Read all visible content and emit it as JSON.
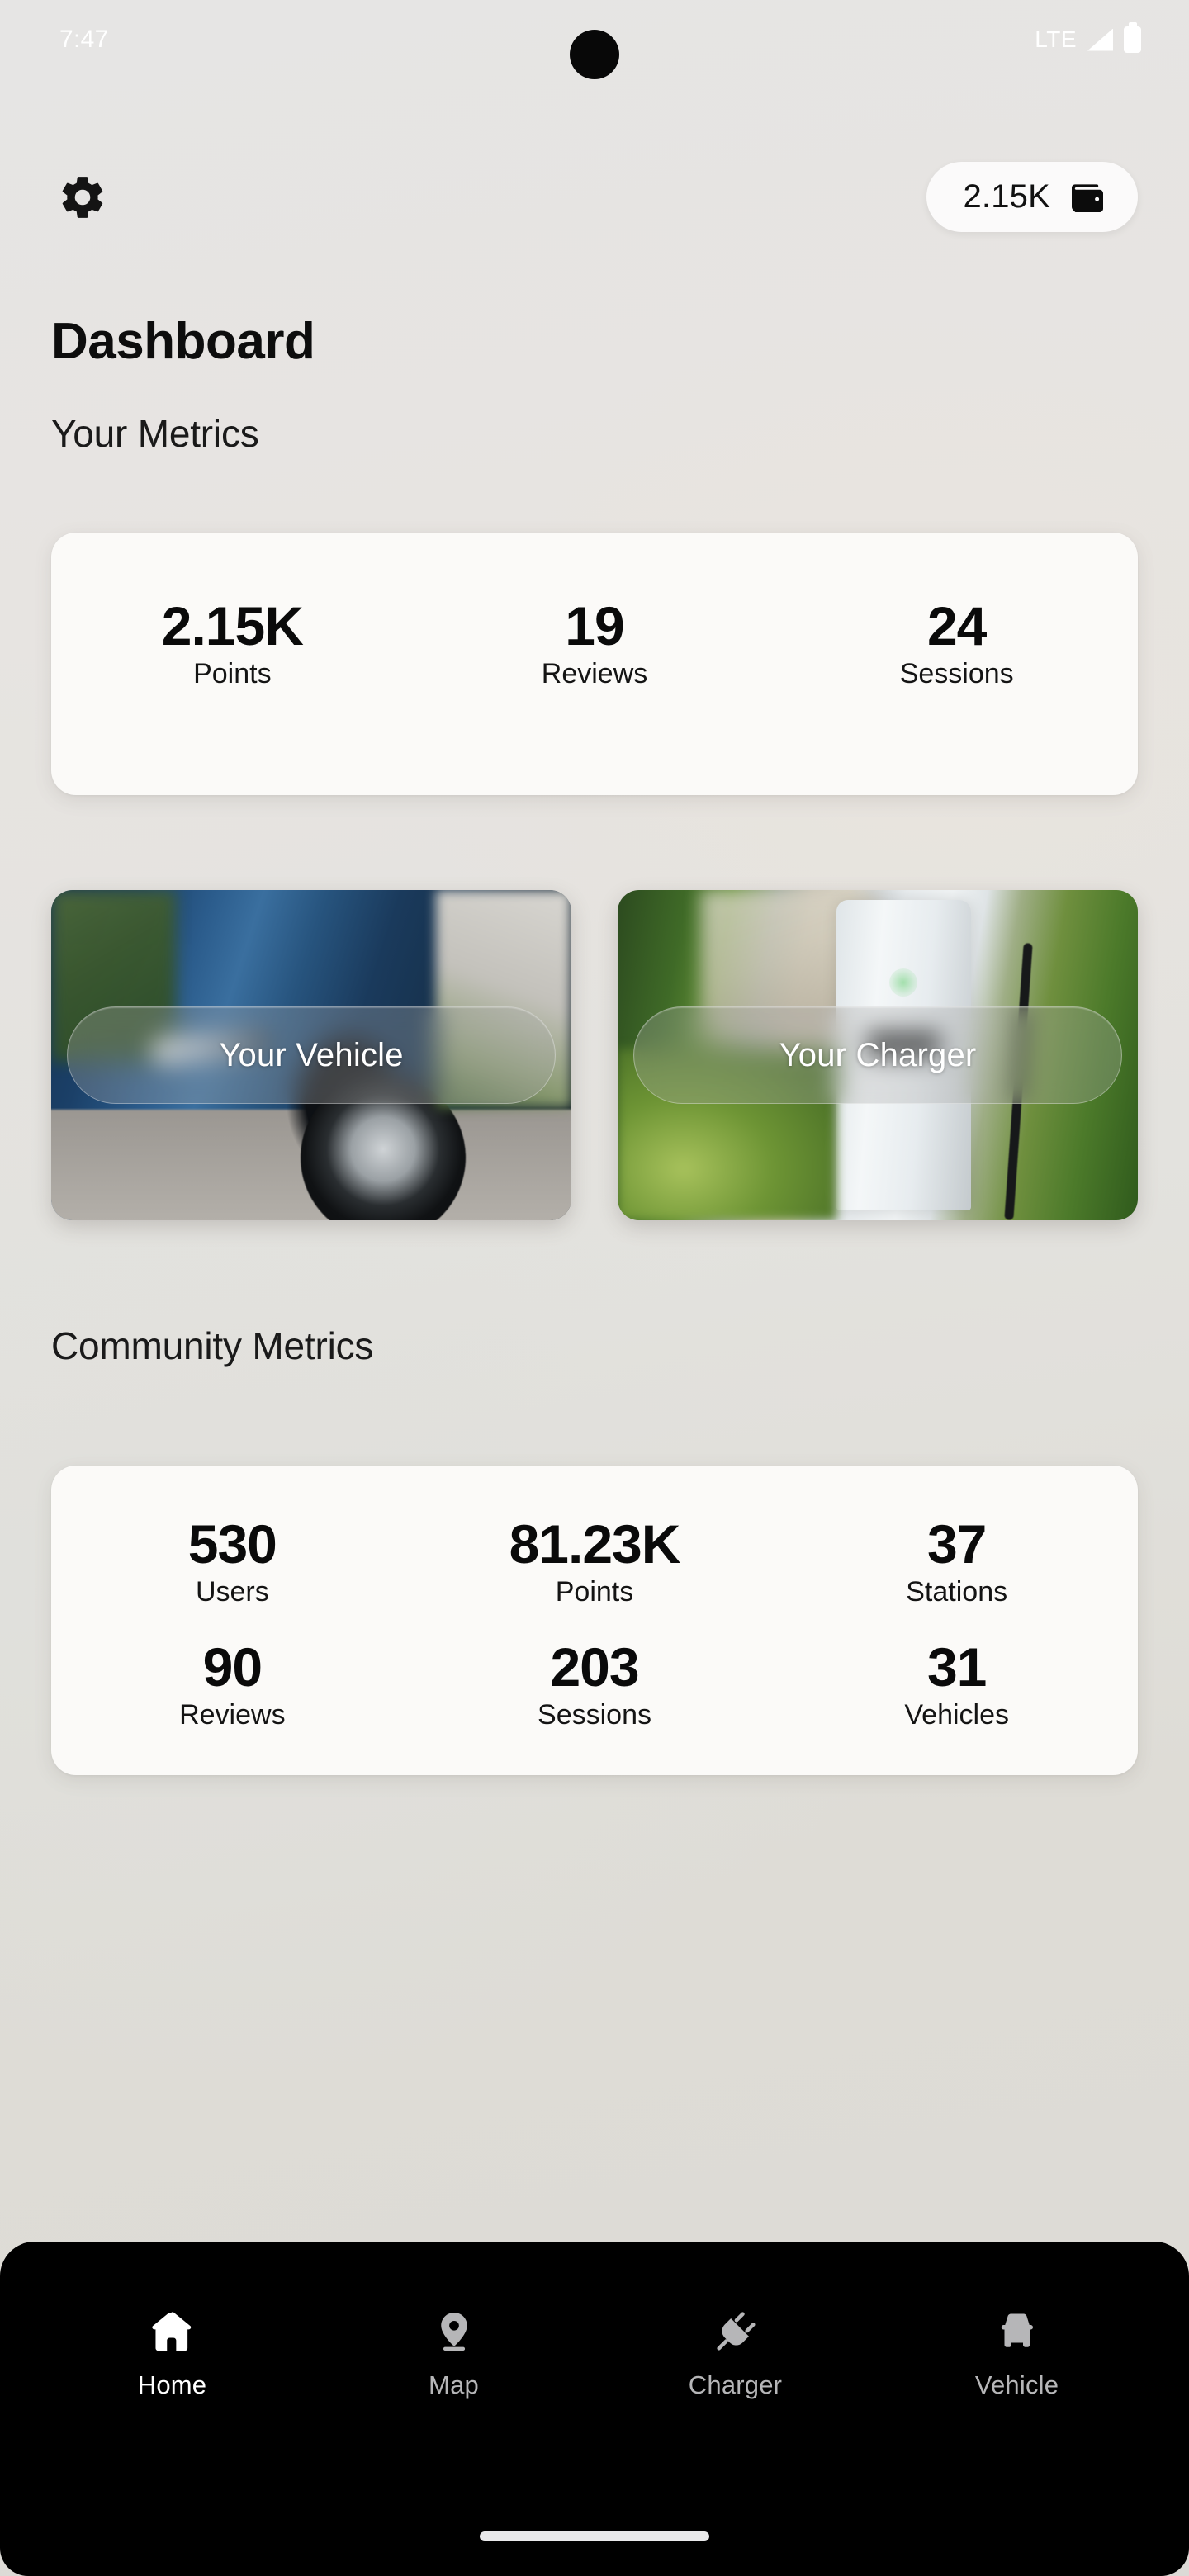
{
  "status_bar": {
    "time": "7:47",
    "network": "LTE",
    "signal_icon": "signal-bars-icon",
    "battery_icon": "battery-full-icon"
  },
  "app_bar": {
    "settings_icon": "gear-icon",
    "wallet": {
      "value": "2.15K",
      "icon": "wallet-icon"
    }
  },
  "page": {
    "title": "Dashboard"
  },
  "your_metrics": {
    "section_title": "Your Metrics",
    "items": [
      {
        "value": "2.15K",
        "label": "Points"
      },
      {
        "value": "19",
        "label": "Reviews"
      },
      {
        "value": "24",
        "label": "Sessions"
      }
    ]
  },
  "tiles": [
    {
      "label": "Your Vehicle",
      "image": "blue-electric-car-photo"
    },
    {
      "label": "Your Charger",
      "image": "ev-charging-station-photo"
    }
  ],
  "community_metrics": {
    "section_title": "Community Metrics",
    "rows": [
      [
        {
          "value": "530",
          "label": "Users"
        },
        {
          "value": "81.23K",
          "label": "Points"
        },
        {
          "value": "37",
          "label": "Stations"
        }
      ],
      [
        {
          "value": "90",
          "label": "Reviews"
        },
        {
          "value": "203",
          "label": "Sessions"
        },
        {
          "value": "31",
          "label": "Vehicles"
        }
      ]
    ]
  },
  "bottom_nav": {
    "items": [
      {
        "label": "Home",
        "icon": "home-icon",
        "active": true
      },
      {
        "label": "Map",
        "icon": "map-pin-icon",
        "active": false
      },
      {
        "label": "Charger",
        "icon": "power-plug-icon",
        "active": false
      },
      {
        "label": "Vehicle",
        "icon": "car-icon",
        "active": false
      }
    ]
  },
  "colors": {
    "accent_dark": "#000000",
    "card_background": "#fbfaf8",
    "active_nav": "#ffffff",
    "inactive_nav": "#b6b6b8"
  }
}
